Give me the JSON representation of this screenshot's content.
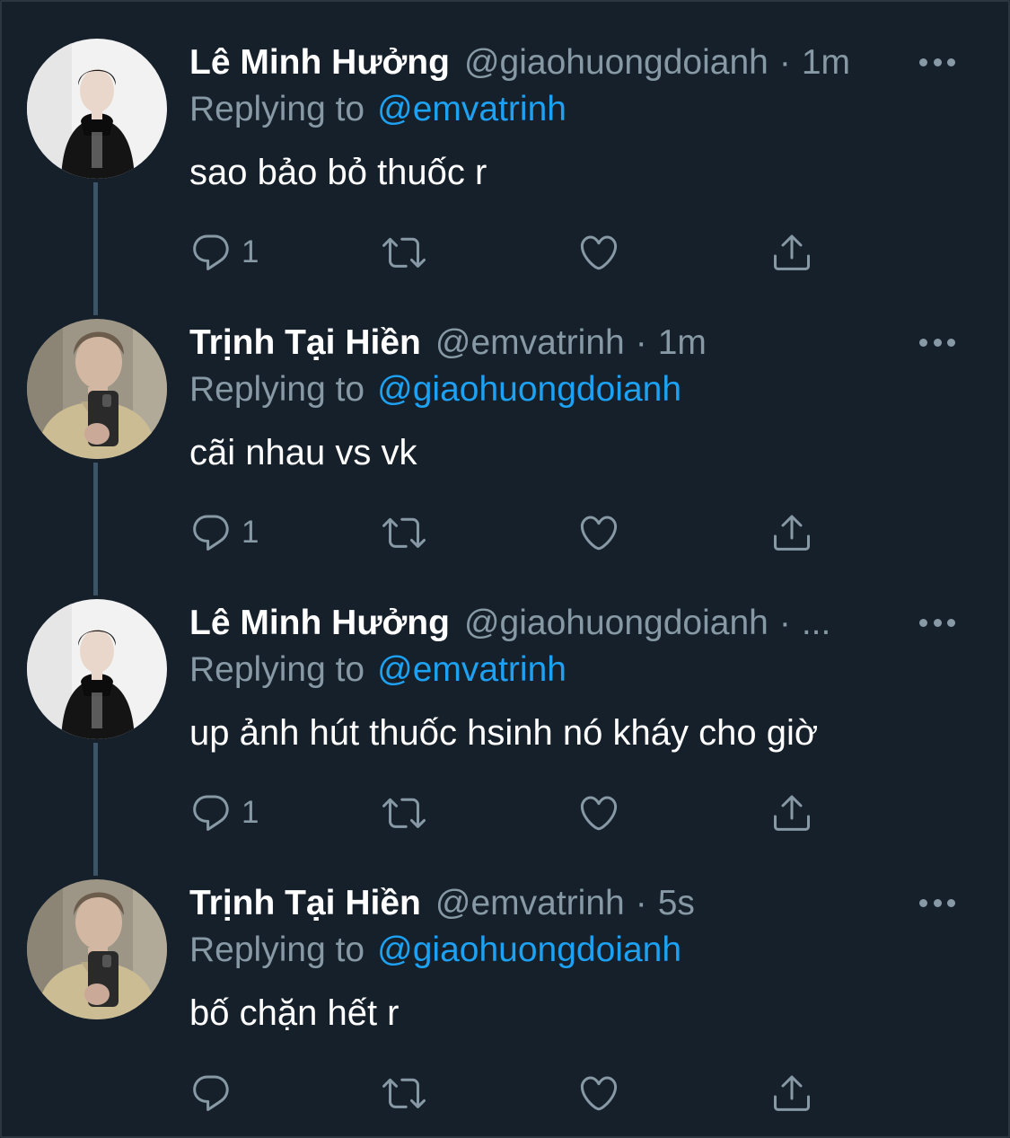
{
  "tweets": [
    {
      "name": "Lê Minh Hưởng",
      "handle": "@giaohuongdoianh",
      "separator": "·",
      "time": "1m",
      "replying_label": "Replying to",
      "replying_to": "@emvatrinh",
      "text": "sao bảo bỏ thuốc r",
      "reply_count": "1",
      "avatar": "avatar-le-minh-huong"
    },
    {
      "name": "Trịnh Tại Hiền",
      "handle": "@emvatrinh",
      "separator": "·",
      "time": "1m",
      "replying_label": "Replying to",
      "replying_to": "@giaohuongdoianh",
      "text": "cãi nhau vs vk",
      "reply_count": "1",
      "avatar": "avatar-trinh-tai-hien"
    },
    {
      "name": "Lê Minh Hưởng",
      "handle": "@giaohuongdoianh",
      "separator": "·",
      "time": "...",
      "replying_label": "Replying to",
      "replying_to": "@emvatrinh",
      "text": "up ảnh hút thuốc hsinh nó kháy cho giờ",
      "reply_count": "1",
      "avatar": "avatar-le-minh-huong"
    },
    {
      "name": "Trịnh Tại Hiền",
      "handle": "@emvatrinh",
      "separator": "·",
      "time": "5s",
      "replying_label": "Replying to",
      "replying_to": "@giaohuongdoianh",
      "text": "bố chặn hết r",
      "reply_count": "",
      "avatar": "avatar-trinh-tai-hien"
    }
  ],
  "icons": {
    "reply": "comment-icon",
    "retweet": "retweet-icon",
    "like": "heart-icon",
    "share": "share-icon",
    "more": "more-icon"
  },
  "colors": {
    "background": "#15202b",
    "secondary_text": "#8899a6",
    "link": "#1da1f2",
    "thread_line": "#3d5466"
  }
}
